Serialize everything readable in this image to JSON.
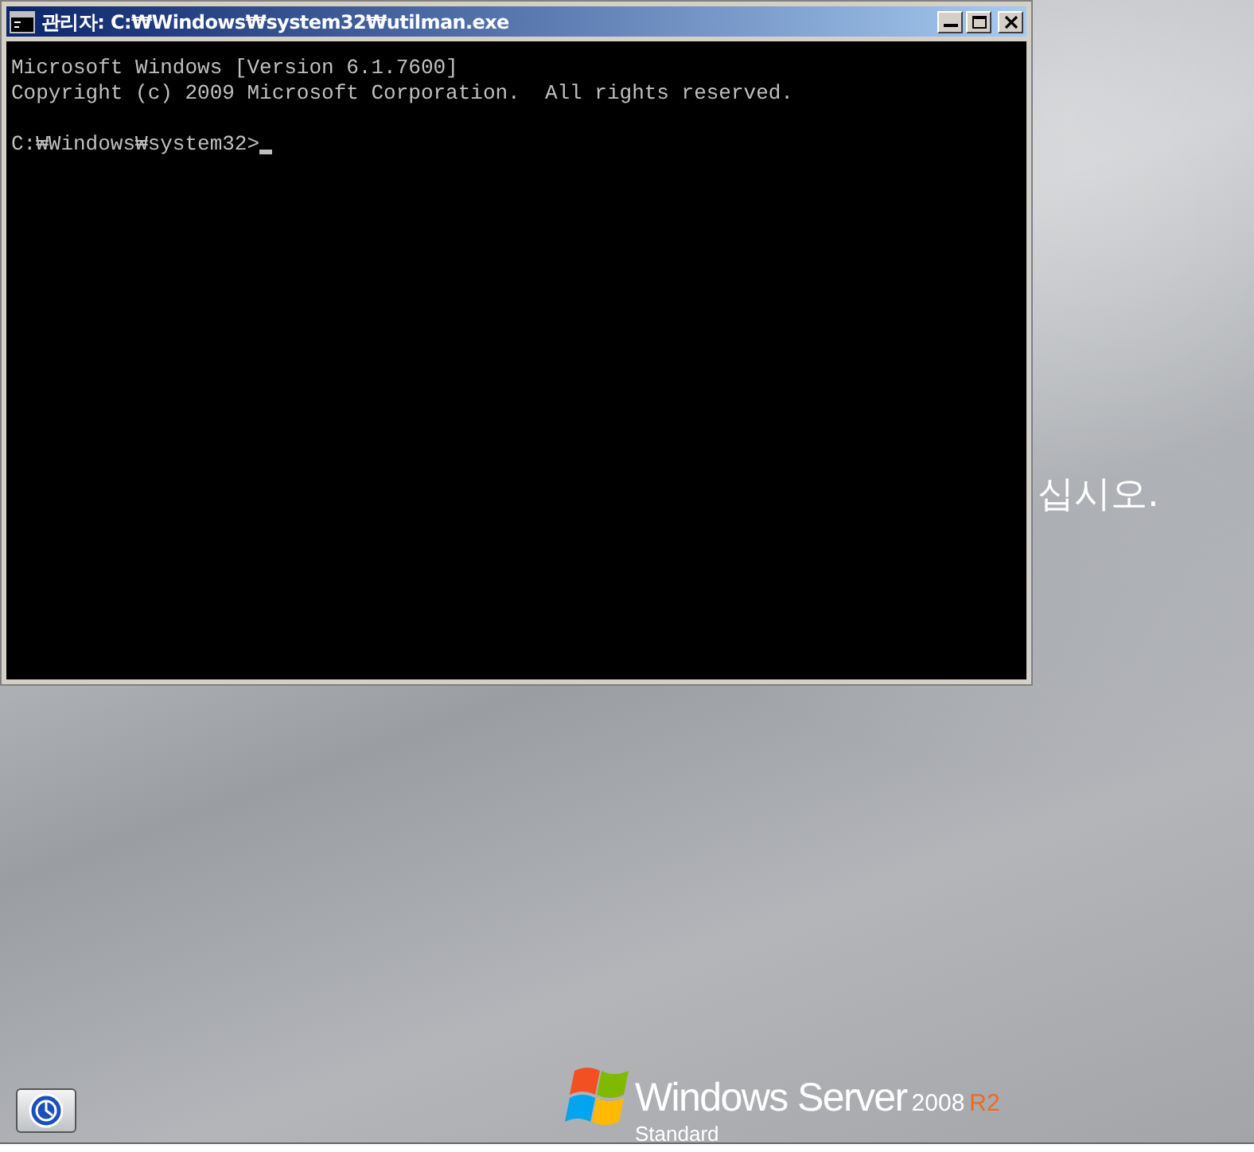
{
  "console": {
    "title": "관리자: C:₩Windows₩system32₩utilman.exe",
    "lines": [
      "Microsoft Windows [Version 6.1.7600]",
      "Copyright (c) 2009 Microsoft Corporation.  All rights reserved."
    ],
    "prompt": "C:₩Windows₩system32>"
  },
  "logon": {
    "message_tail": "십시오."
  },
  "branding": {
    "product": "Windows Server",
    "version": "2008",
    "release": "R2",
    "edition": "Standard"
  }
}
